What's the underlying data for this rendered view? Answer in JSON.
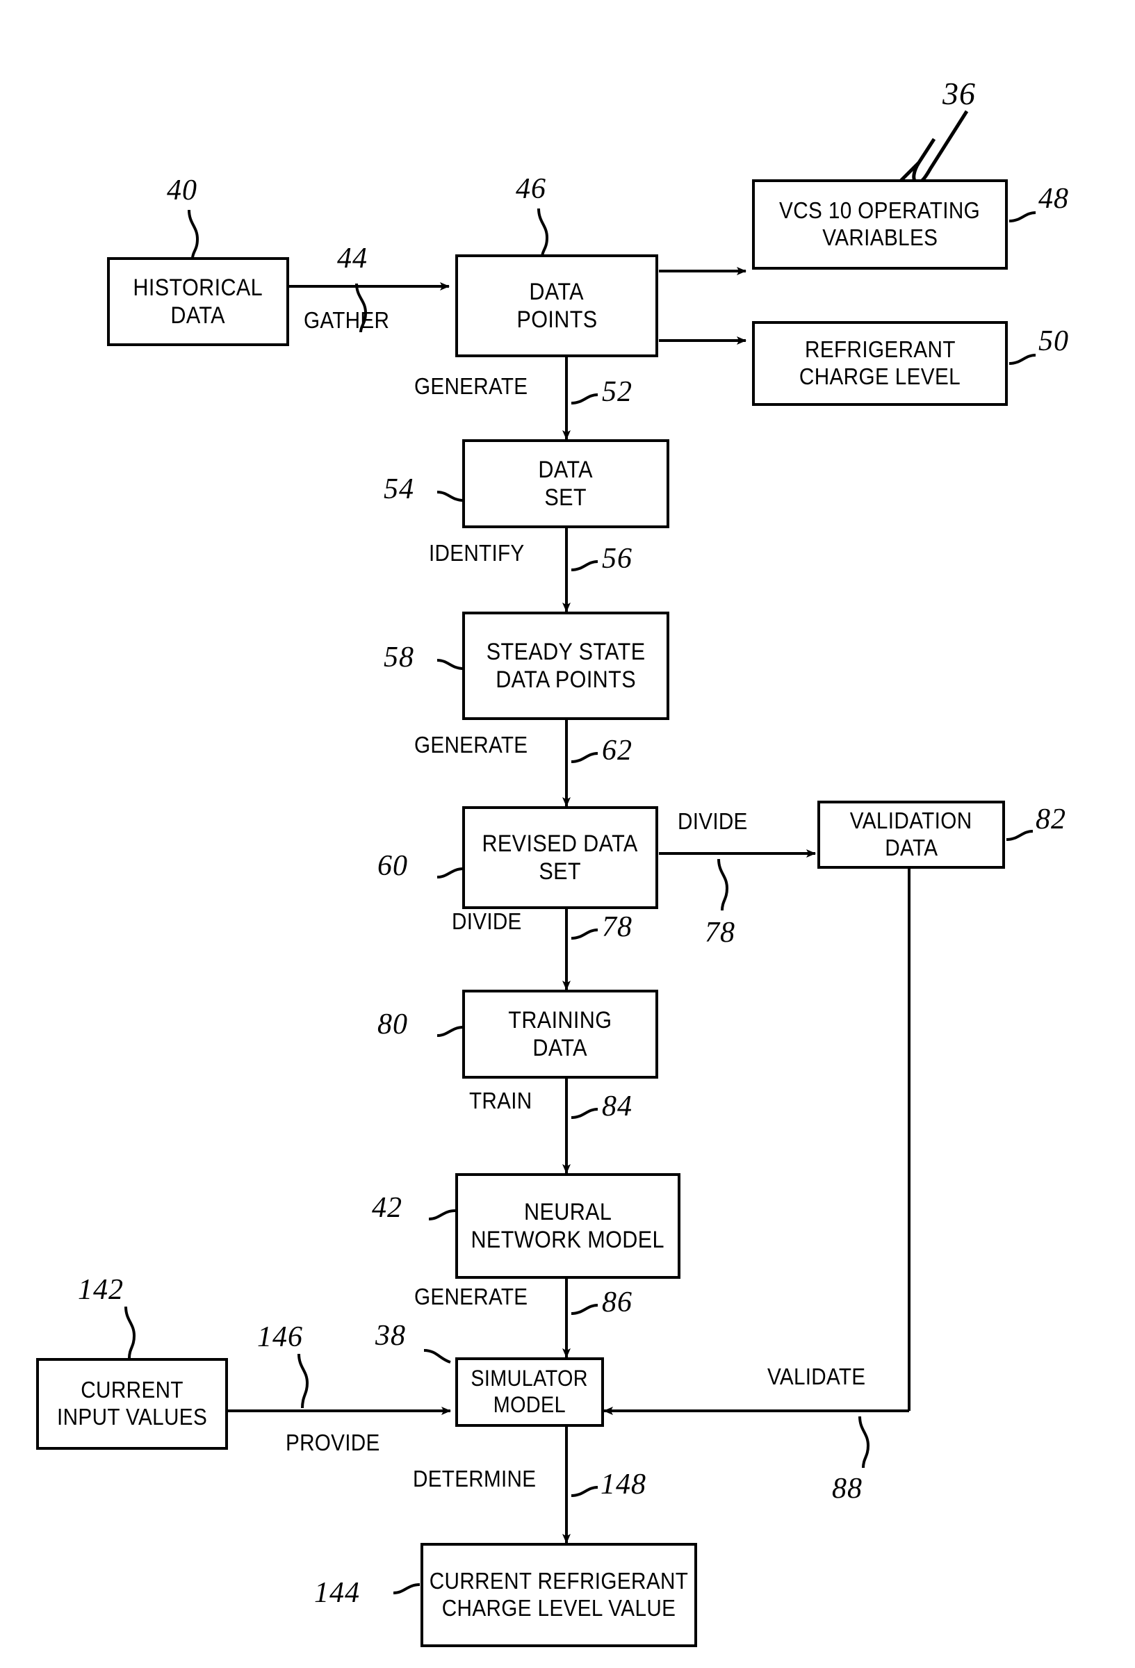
{
  "figure": {
    "figure_ref": "36"
  },
  "boxes": {
    "historical_data": {
      "line1": "HISTORICAL",
      "line2": "DATA",
      "ref": "40"
    },
    "data_points": {
      "line1": "DATA",
      "line2": "POINTS",
      "ref": "46"
    },
    "vcs_operating_variables": {
      "line1": "VCS 10 OPERATING",
      "line2": "VARIABLES",
      "ref": "48"
    },
    "refrigerant_charge_level": {
      "line1": "REFRIGERANT",
      "line2": "CHARGE LEVEL",
      "ref": "50"
    },
    "data_set": {
      "line1": "DATA",
      "line2": "SET",
      "ref": "54"
    },
    "steady_state_data_points": {
      "line1": "STEADY STATE",
      "line2": "DATA POINTS",
      "ref": "58"
    },
    "revised_data_set": {
      "line1": "REVISED DATA",
      "line2": "SET",
      "ref": "60"
    },
    "validation_data": {
      "line1": "VALIDATION",
      "line2": "DATA",
      "ref": "82"
    },
    "training_data": {
      "line1": "TRAINING",
      "line2": "DATA",
      "ref": "80"
    },
    "neural_network_model": {
      "line1": "NEURAL",
      "line2": "NETWORK MODEL",
      "ref": "42"
    },
    "current_input_values": {
      "line1": "CURRENT",
      "line2": "INPUT VALUES",
      "ref": "142"
    },
    "simulator_model": {
      "line1": "SIMULATOR",
      "line2": "MODEL",
      "ref": "38"
    },
    "current_refrigerant_charge_level_value": {
      "line1": "CURRENT REFRIGERANT",
      "line2": "CHARGE LEVEL VALUE",
      "ref": "144"
    }
  },
  "edges": {
    "gather": {
      "label": "GATHER",
      "ref": "44"
    },
    "generate_data_set": {
      "label": "GENERATE",
      "ref": "52"
    },
    "identify": {
      "label": "IDENTIFY",
      "ref": "56"
    },
    "generate_revised": {
      "label": "GENERATE",
      "ref": "62"
    },
    "divide_validation": {
      "label": "DIVIDE",
      "ref": "78"
    },
    "divide_training": {
      "label": "DIVIDE",
      "ref": "78"
    },
    "train": {
      "label": "TRAIN",
      "ref": "84"
    },
    "generate_simulator": {
      "label": "GENERATE",
      "ref": "86"
    },
    "provide": {
      "label": "PROVIDE",
      "ref": "146"
    },
    "validate": {
      "label": "VALIDATE",
      "ref": "88"
    },
    "determine": {
      "label": "DETERMINE",
      "ref": "148"
    }
  }
}
